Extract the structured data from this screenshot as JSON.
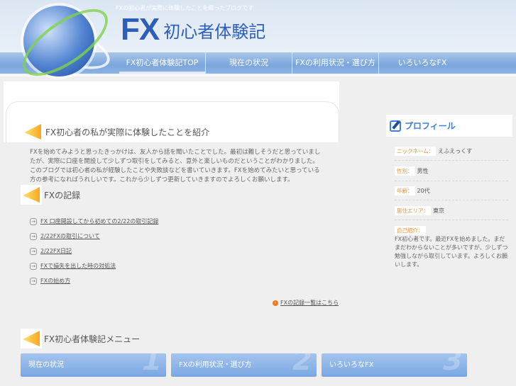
{
  "header": {
    "tagline": "FXの初心者が実際に体験したことを綴ったブログです",
    "logo_fx": "FX",
    "logo_ja": "初心者体験記"
  },
  "nav": [
    {
      "label": "FX初心者体験記TOP"
    },
    {
      "label": "現在の状況"
    },
    {
      "label": "FXの利用状況・選び方"
    },
    {
      "label": "いろいろなFX"
    }
  ],
  "main": {
    "intro_heading": "FX初心者の私が実際に体験したことを紹介",
    "intro_text": "FXを始めてみようと思ったきっかけは、友人から話を聞いたことでした。最初は難しそうだと思っていましたが、実際に口座を開設して少しずつ取引をしてみると、意外と楽しいものだということがわかりました。このブログでは初心者の私が経験したことや失敗談などを書いていきます。FXを始めてみたいと思っている方の参考になればうれしいです。これから少しずつ更新していきますのでよろしくお願いします。",
    "news_heading": "FXの記録",
    "news": [
      {
        "label": "FX 口座開設してから初めての2/22の取引記録"
      },
      {
        "label": "2/22FXの取引について"
      },
      {
        "label": "2/22FX日記"
      },
      {
        "label": "FXで損失を出した時の対処法"
      },
      {
        "label": "FXの始め方"
      }
    ],
    "more_link": "FXの記録一覧はこちら",
    "menu_heading": "FX初心者体験記メニュー",
    "cards": [
      {
        "label": "現在の状況",
        "num": "1"
      },
      {
        "label": "FXの利用状況・選び方",
        "num": "2"
      },
      {
        "label": "いろいろなFX",
        "num": "3"
      }
    ]
  },
  "sidebar": {
    "title": "プロフィール",
    "fields": [
      {
        "label": "ニックネーム：",
        "value": "えふえっくす"
      },
      {
        "label": "性別：",
        "value": "男性"
      },
      {
        "label": "年齢：",
        "value": "20代"
      },
      {
        "label": "居住エリア：",
        "value": "東京"
      }
    ],
    "intro_label": "自己紹介：",
    "intro_text": "FX初心者です。最近FXを始めました。まだまだわからないことが多いですが、少しずつ勉強しながら取引しています。よろしくお願いします。"
  }
}
